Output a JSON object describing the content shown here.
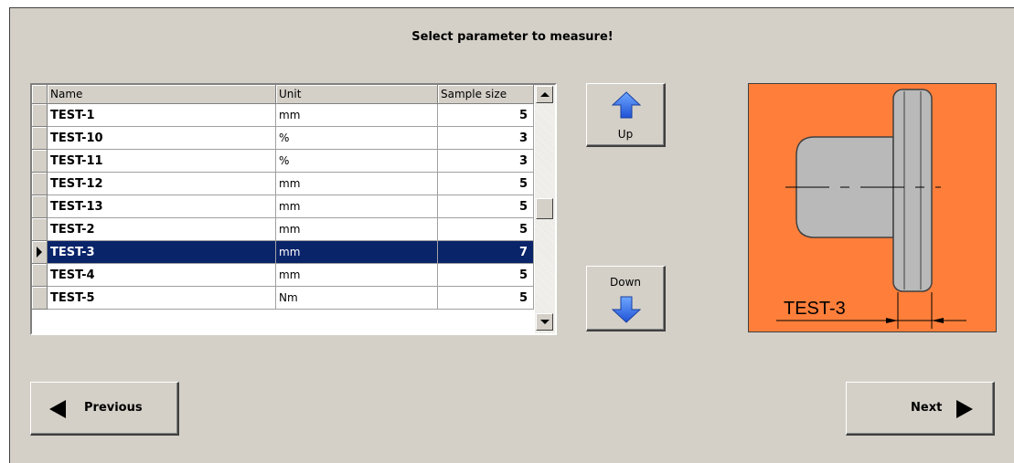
{
  "window": {
    "title": "Select parameter to measure!"
  },
  "grid": {
    "columns": [
      "Name",
      "Unit",
      "Sample size"
    ],
    "rows": [
      {
        "name": "TEST-1",
        "unit": "mm",
        "sample_size": "5"
      },
      {
        "name": "TEST-10",
        "unit": "%",
        "sample_size": "3"
      },
      {
        "name": "TEST-11",
        "unit": "%",
        "sample_size": "3"
      },
      {
        "name": "TEST-12",
        "unit": "mm",
        "sample_size": "5"
      },
      {
        "name": "TEST-13",
        "unit": "mm",
        "sample_size": "5"
      },
      {
        "name": "TEST-2",
        "unit": "mm",
        "sample_size": "5"
      },
      {
        "name": "TEST-3",
        "unit": "mm",
        "sample_size": "7"
      },
      {
        "name": "TEST-4",
        "unit": "mm",
        "sample_size": "5"
      },
      {
        "name": "TEST-5",
        "unit": "Nm",
        "sample_size": "5"
      }
    ],
    "selected_index": 6
  },
  "buttons": {
    "up": "Up",
    "down": "Down",
    "previous": "Previous",
    "next": "Next"
  },
  "preview": {
    "label": "TEST-3",
    "background_color": "#ff7f3a"
  },
  "colors": {
    "selection": "#0a246a",
    "window_bg": "#d4d0c8"
  }
}
